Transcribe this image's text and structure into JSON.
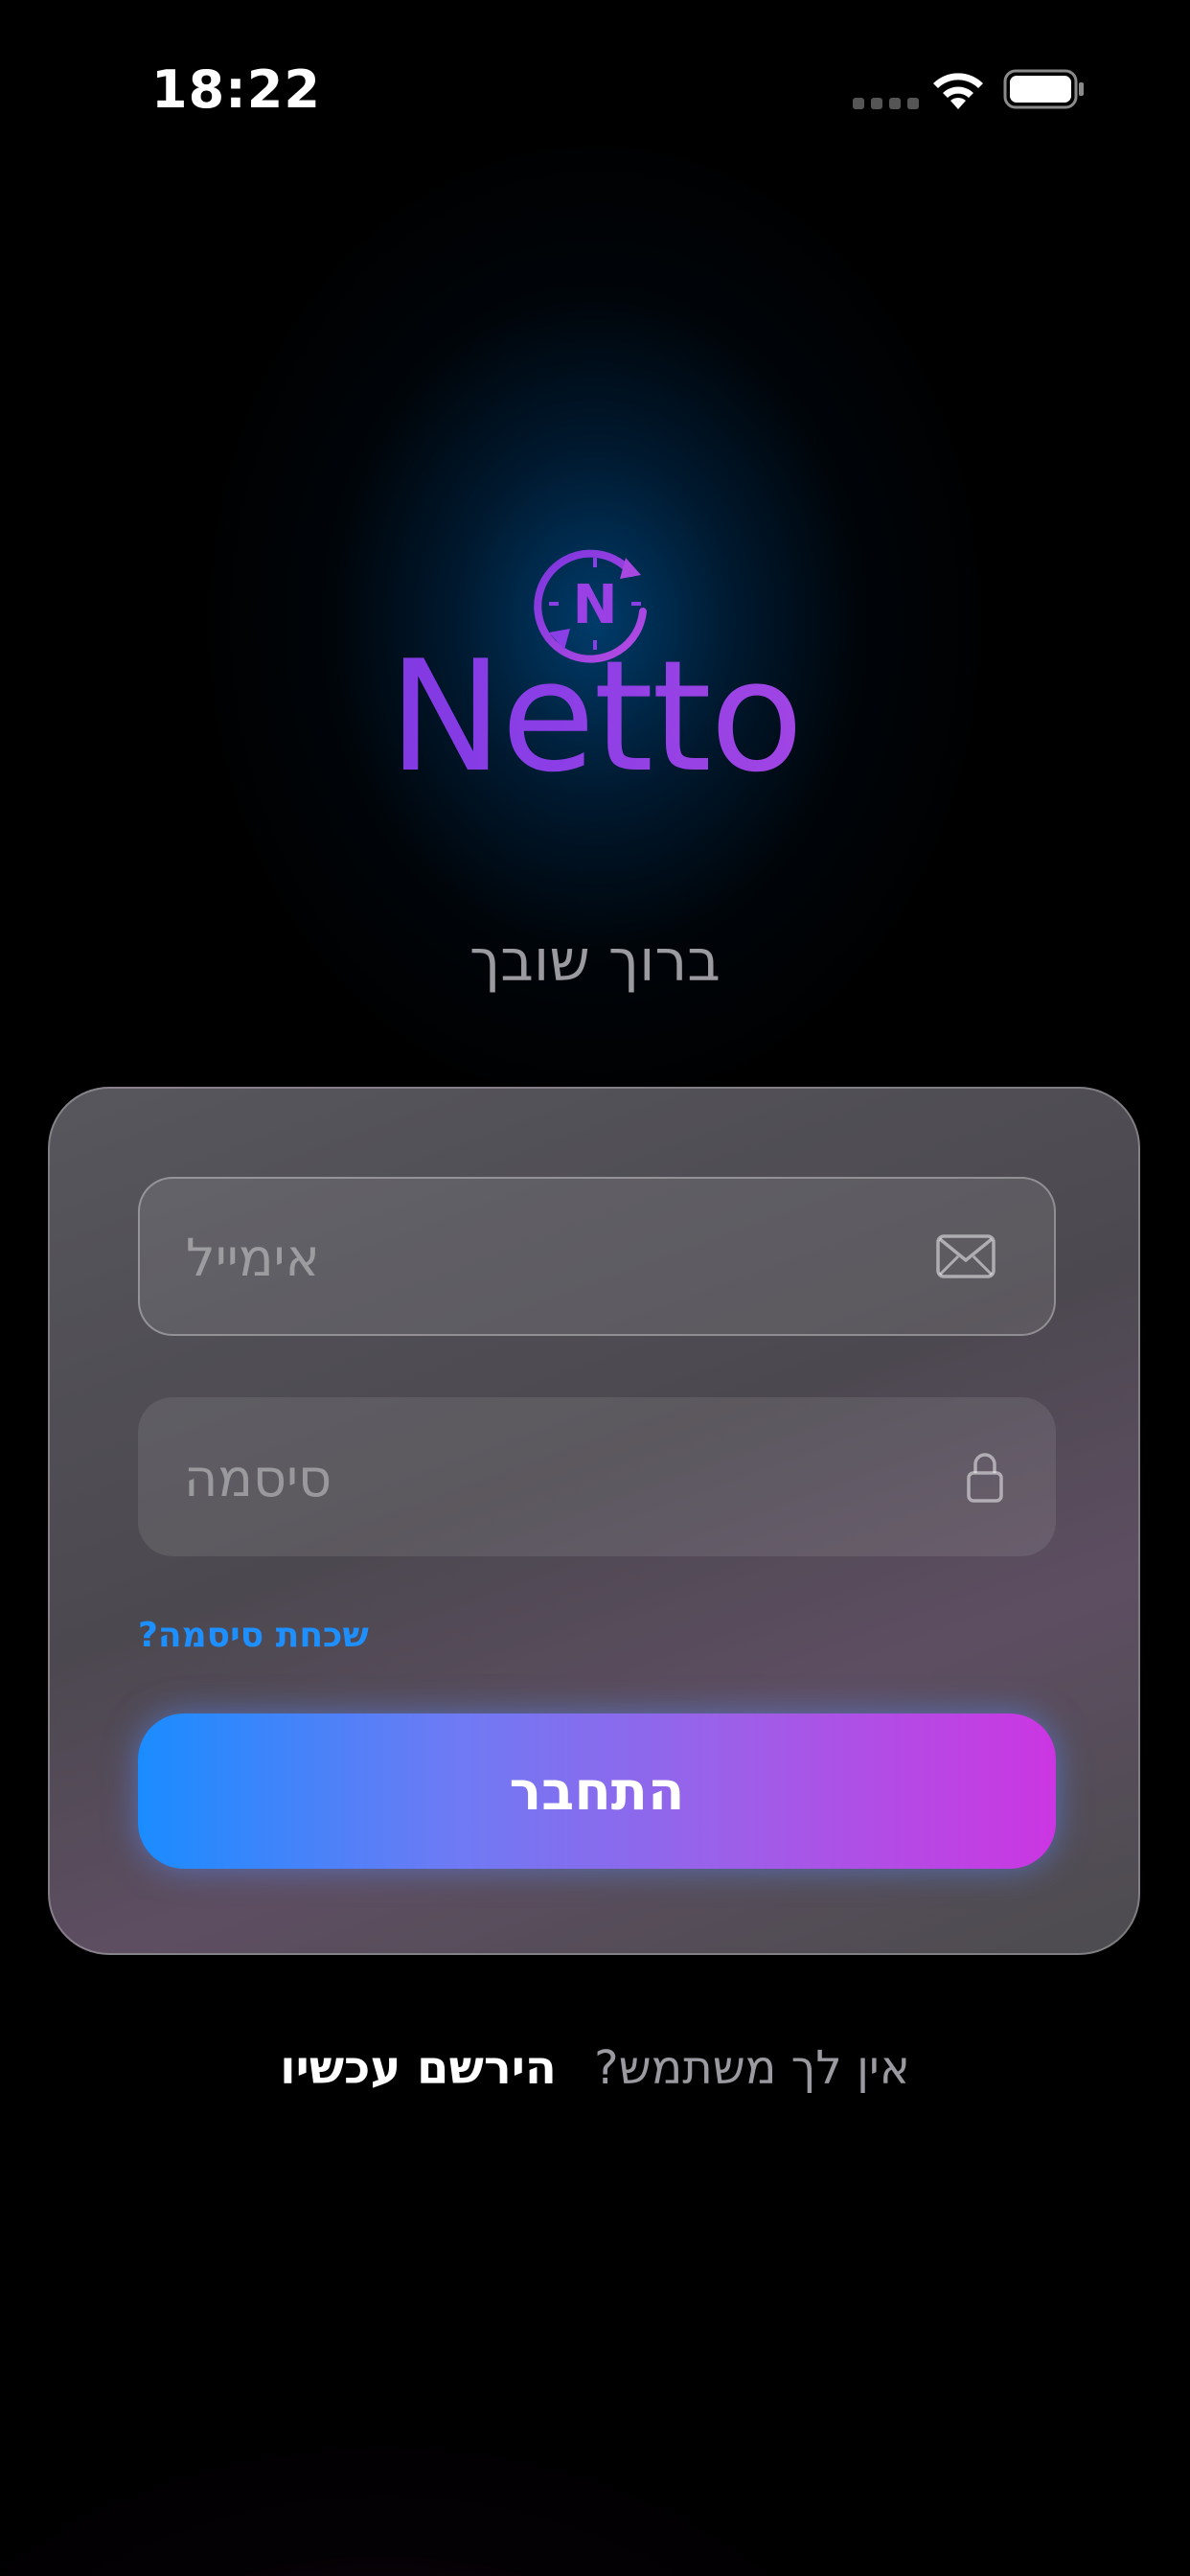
{
  "status_bar": {
    "time": "18:22",
    "icons": [
      "cellular-signal-icon",
      "wifi-icon",
      "battery-icon"
    ]
  },
  "logo": {
    "icon": "netto-compass-logo-icon",
    "letter": "N",
    "name": "Netto"
  },
  "welcome_text": "ברוך שובך",
  "login_form": {
    "email": {
      "placeholder": "אימייל",
      "value": "",
      "icon": "envelope-icon"
    },
    "password": {
      "placeholder": "סיסמה",
      "value": "",
      "icon": "lock-icon"
    },
    "forgot_password_label": "שכחת סיסמה?",
    "login_button_label": "התחבר"
  },
  "signup_prompt": {
    "question": "אין לך משתמש?",
    "link_label": "הירשם עכשיו"
  },
  "colors": {
    "accent_blue": "#1e8fff",
    "accent_purple": "#cb36e2",
    "logo_purple": "#8a3ee6",
    "background": "#000000"
  }
}
